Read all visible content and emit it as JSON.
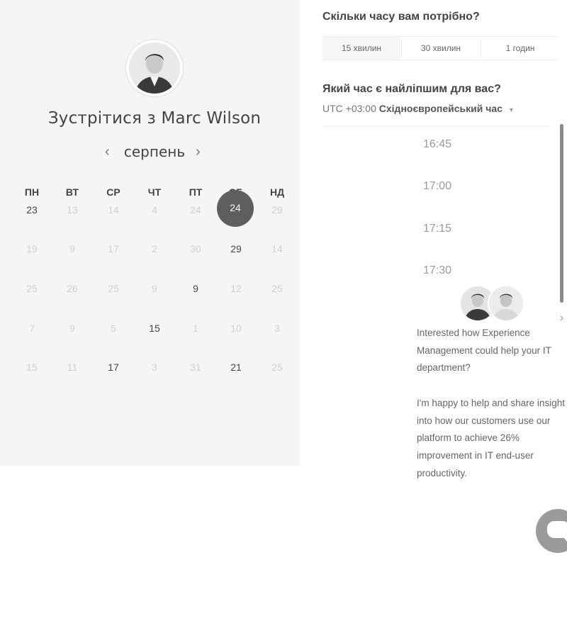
{
  "calendar": {
    "title": "Зустрітися з Marc Wilson",
    "month": "серпень",
    "prev_icon": "chevron-left-icon",
    "next_icon": "chevron-right-icon",
    "weekdays": [
      "ПН",
      "ВТ",
      "СР",
      "ЧТ",
      "ПТ",
      "СБ",
      "НД"
    ],
    "weeks": [
      [
        "23",
        "13",
        "14",
        "4",
        "24",
        "24",
        "29"
      ],
      [
        "19",
        "9",
        "17",
        "2",
        "30",
        "29",
        "14"
      ],
      [
        "25",
        "26",
        "25",
        "9",
        "9",
        "12",
        "25"
      ],
      [
        "7",
        "9",
        "5",
        "15",
        "1",
        "10",
        "3"
      ],
      [
        "15",
        "11",
        "17",
        "3",
        "31",
        "21",
        "25"
      ]
    ],
    "selected_day": "24"
  },
  "booking": {
    "duration_heading": "Скільки часу вам потрібно?",
    "durations": [
      "15 хвилин",
      "30 хвилин",
      "1 годин"
    ],
    "time_heading": "Який час є найліпшим для вас?",
    "timezone_offset": "UTC +03:00",
    "timezone_name": "Східноєвропейський час",
    "slots": [
      "16:45",
      "17:00",
      "17:15",
      "17:30"
    ]
  },
  "chat": {
    "message_1": "Interested how Experience Management could help your IT department?",
    "message_2": "I'm happy to help and share insight into how our customers use our platform to achieve 26% improvement in IT end-user productivity.",
    "close_icon": "chevron-right-icon",
    "launcher_icon": "chat-bubble-icon"
  },
  "colors": {
    "panel_bg": "#f5f5f5",
    "selected_day_bg": "#5e5e5e",
    "launcher_bg": "#9b9b9b"
  }
}
